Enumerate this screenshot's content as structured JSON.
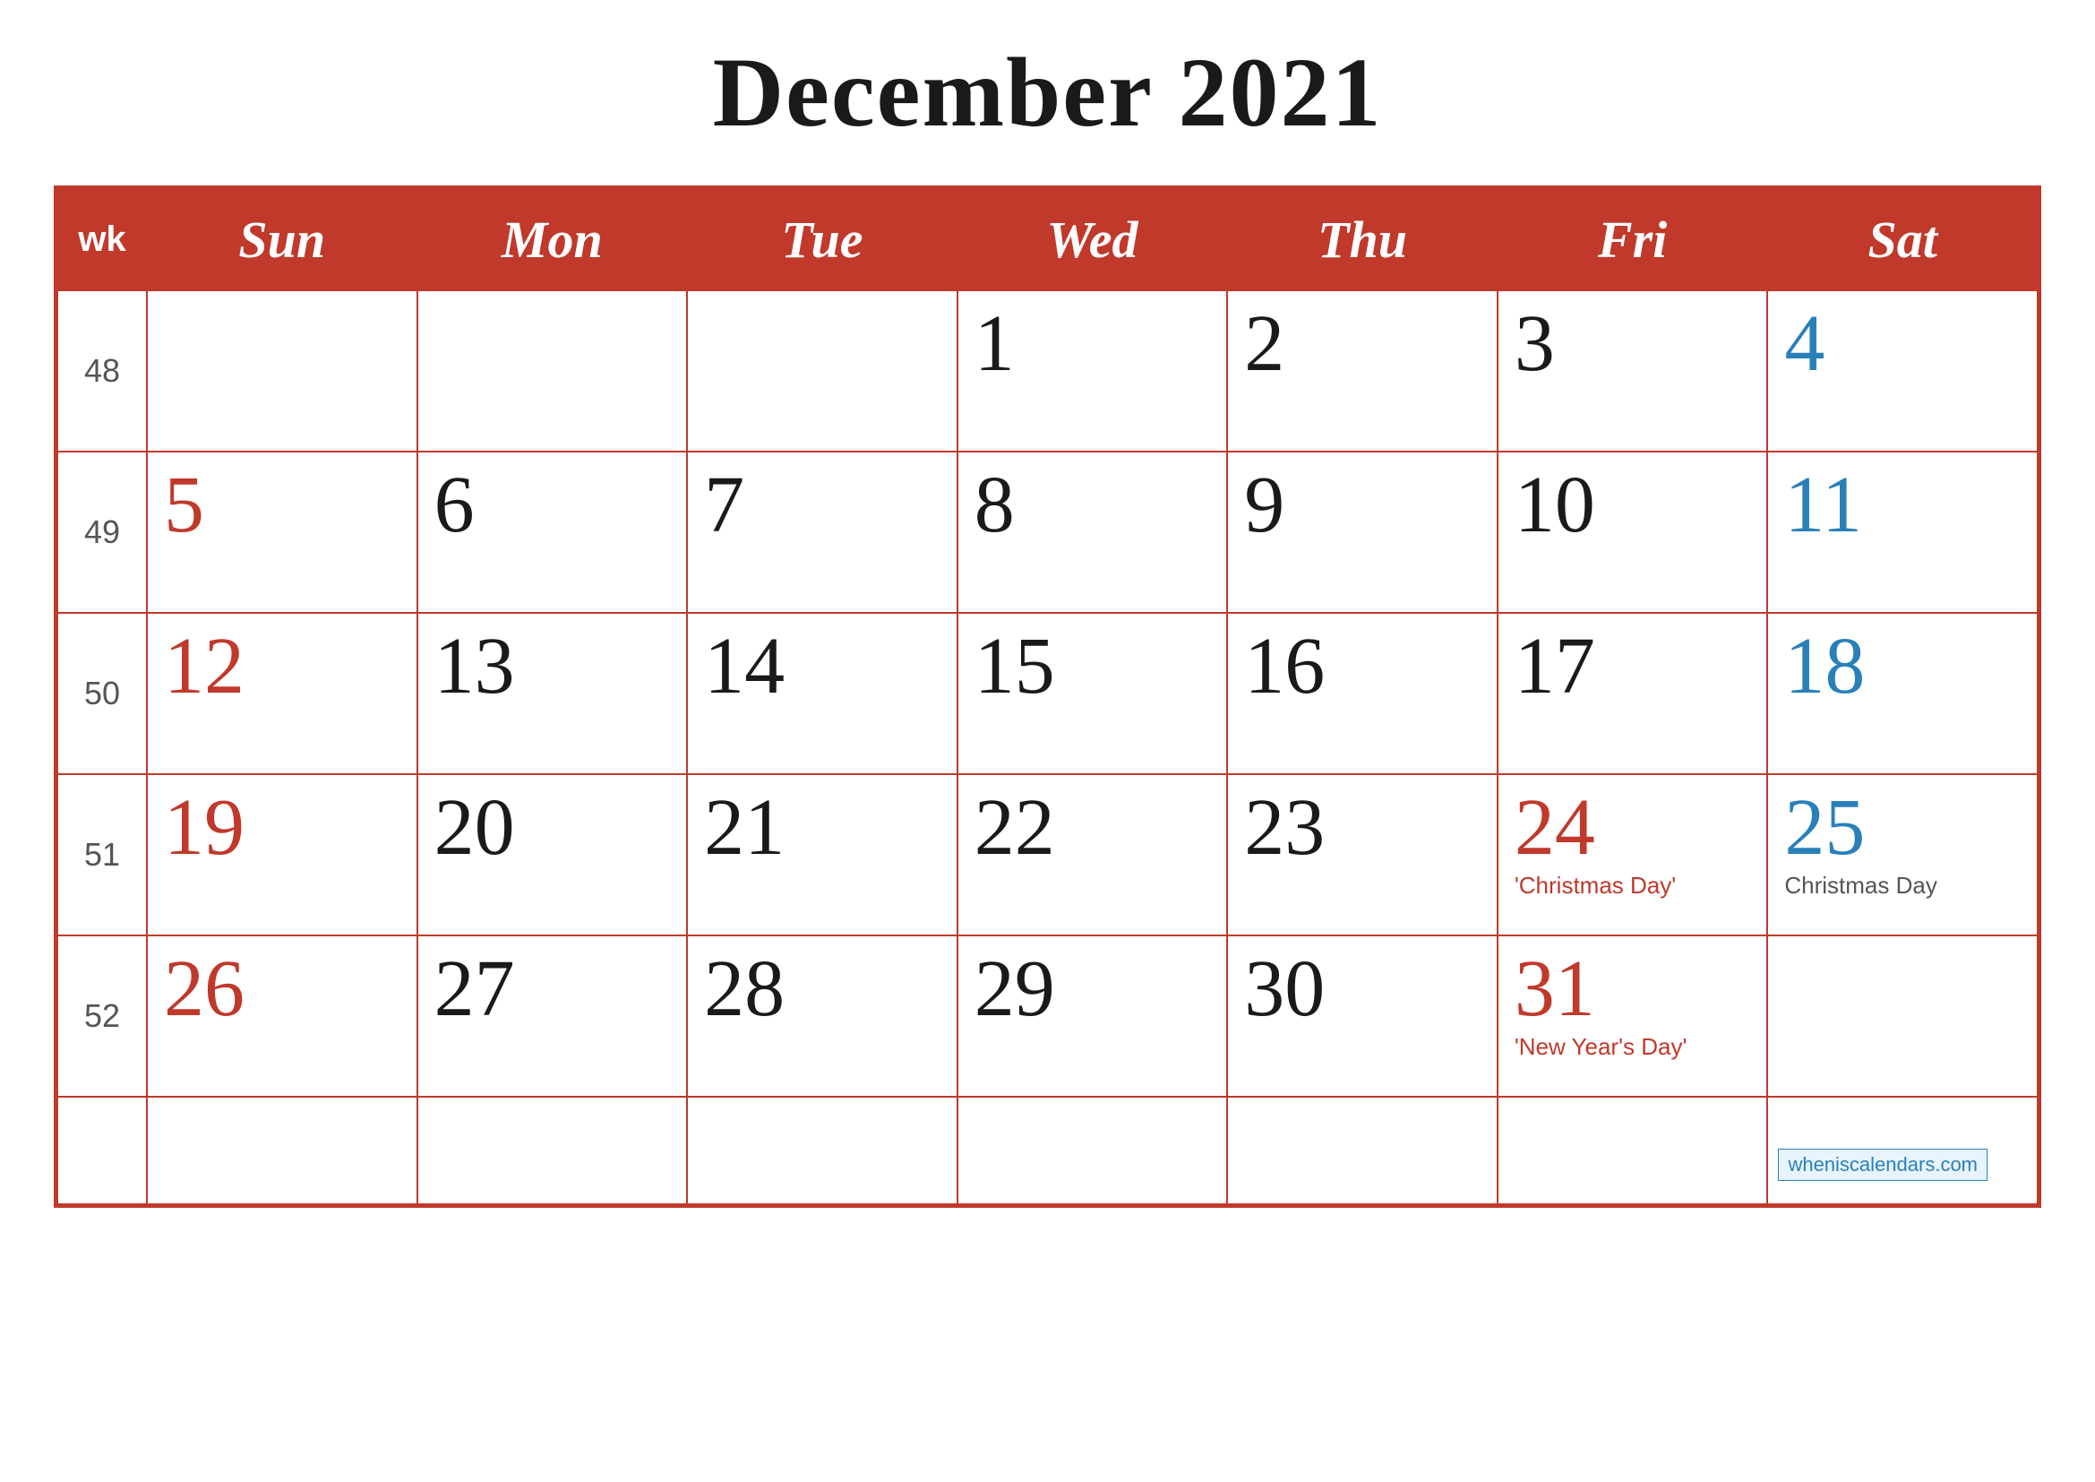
{
  "title": "December 2021",
  "header": {
    "wk": "wk",
    "days": [
      "Sun",
      "Mon",
      "Tue",
      "Wed",
      "Thu",
      "Fri",
      "Sat"
    ]
  },
  "weeks": [
    {
      "wk": "48",
      "days": [
        {
          "num": "",
          "color": "black"
        },
        {
          "num": "",
          "color": "black"
        },
        {
          "num": "",
          "color": "black"
        },
        {
          "num": "1",
          "color": "black"
        },
        {
          "num": "2",
          "color": "black"
        },
        {
          "num": "3",
          "color": "black"
        },
        {
          "num": "4",
          "color": "blue"
        }
      ]
    },
    {
      "wk": "49",
      "days": [
        {
          "num": "5",
          "color": "red"
        },
        {
          "num": "6",
          "color": "black"
        },
        {
          "num": "7",
          "color": "black"
        },
        {
          "num": "8",
          "color": "black"
        },
        {
          "num": "9",
          "color": "black"
        },
        {
          "num": "10",
          "color": "black"
        },
        {
          "num": "11",
          "color": "blue"
        }
      ]
    },
    {
      "wk": "50",
      "days": [
        {
          "num": "12",
          "color": "red"
        },
        {
          "num": "13",
          "color": "black"
        },
        {
          "num": "14",
          "color": "black"
        },
        {
          "num": "15",
          "color": "black"
        },
        {
          "num": "16",
          "color": "black"
        },
        {
          "num": "17",
          "color": "black"
        },
        {
          "num": "18",
          "color": "blue"
        }
      ]
    },
    {
      "wk": "51",
      "days": [
        {
          "num": "19",
          "color": "red"
        },
        {
          "num": "20",
          "color": "black"
        },
        {
          "num": "21",
          "color": "black"
        },
        {
          "num": "22",
          "color": "black"
        },
        {
          "num": "23",
          "color": "black"
        },
        {
          "num": "24",
          "color": "red",
          "holiday": "'Christmas Day'",
          "holidayColor": "red-label"
        },
        {
          "num": "25",
          "color": "blue",
          "holiday": "Christmas Day",
          "holidayColor": ""
        }
      ]
    },
    {
      "wk": "52",
      "days": [
        {
          "num": "26",
          "color": "red"
        },
        {
          "num": "27",
          "color": "black"
        },
        {
          "num": "28",
          "color": "black"
        },
        {
          "num": "29",
          "color": "black"
        },
        {
          "num": "30",
          "color": "black"
        },
        {
          "num": "31",
          "color": "red",
          "holiday": "'New Year's Day'",
          "holidayColor": "red-label"
        },
        {
          "num": "",
          "color": "black"
        }
      ]
    },
    {
      "wk": "",
      "days": [
        {
          "num": "",
          "color": "black"
        },
        {
          "num": "",
          "color": "black"
        },
        {
          "num": "",
          "color": "black"
        },
        {
          "num": "",
          "color": "black"
        },
        {
          "num": "",
          "color": "black"
        },
        {
          "num": "",
          "color": "black"
        },
        {
          "num": "",
          "color": "black"
        }
      ]
    }
  ],
  "watermark": "wheniscalendars.com"
}
